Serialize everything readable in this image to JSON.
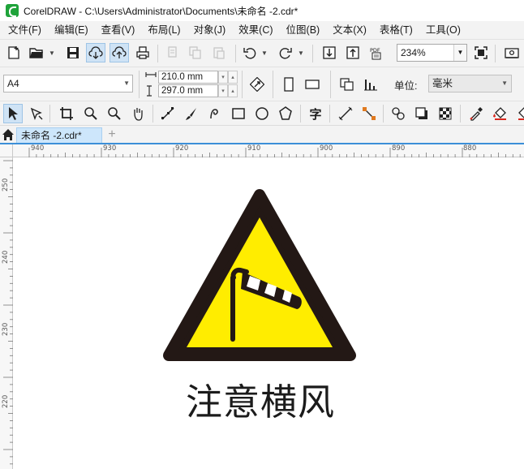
{
  "window": {
    "title": "CorelDRAW - C:\\Users\\Administrator\\Documents\\未命名 -2.cdr*"
  },
  "menu": [
    {
      "label": "文件(F)",
      "mnemonic": "F"
    },
    {
      "label": "编辑(E)",
      "mnemonic": "E"
    },
    {
      "label": "查看(V)",
      "mnemonic": "V"
    },
    {
      "label": "布局(L)",
      "mnemonic": "L"
    },
    {
      "label": "对象(J)",
      "mnemonic": "J"
    },
    {
      "label": "效果(C)",
      "mnemonic": "C"
    },
    {
      "label": "位图(B)",
      "mnemonic": "B"
    },
    {
      "label": "文本(X)",
      "mnemonic": "X"
    },
    {
      "label": "表格(T)",
      "mnemonic": "T"
    },
    {
      "label": "工具(O)",
      "mnemonic": "O"
    }
  ],
  "standard_toolbar": {
    "zoom_level": "234%",
    "icons": [
      "new-doc-icon",
      "open-folder-icon",
      "save-icon",
      "cloud-download-icon",
      "cloud-upload-icon",
      "print-icon",
      "cut-icon",
      "copy-icon",
      "paste-icon",
      "undo-icon",
      "redo-icon",
      "import-icon",
      "export-icon",
      "export-pdf-icon",
      "full-screen-icon",
      "options-icon"
    ],
    "pdf_label": "PDF"
  },
  "property_bar": {
    "page_size": "A4",
    "width": "210.0 mm",
    "height": "297.0 mm",
    "unit_label": "单位:",
    "unit_value": "毫米"
  },
  "toolbox": [
    "pick-tool-icon",
    "shape-tool-icon",
    "crop-tool-icon",
    "zoom-tool-icon",
    "zoom-out-icon",
    "pan-tool-icon",
    "bezier-tool-icon",
    "artistic-media-icon",
    "spiral-tool-icon",
    "rectangle-tool-icon",
    "ellipse-tool-icon",
    "polygon-tool-icon",
    "text-tool-icon",
    "dimension-tool-icon",
    "connector-tool-icon",
    "blend-tool-icon",
    "drop-shadow-icon",
    "transparency-icon",
    "eyedropper-icon",
    "fill-tool-icon",
    "interactive-fill-icon"
  ],
  "text_tool_glyph": "字",
  "document_tab": {
    "label": "未命名 -2.cdr*",
    "new_tab": "+"
  },
  "ruler_h_labels": [
    "940",
    "930",
    "920",
    "910",
    "900",
    "890",
    "880"
  ],
  "ruler_v_labels": [
    "250",
    "240",
    "230",
    "220"
  ],
  "sign": {
    "caption": "注意横风",
    "fill_color": "#ffed00",
    "border_color": "#231815"
  }
}
